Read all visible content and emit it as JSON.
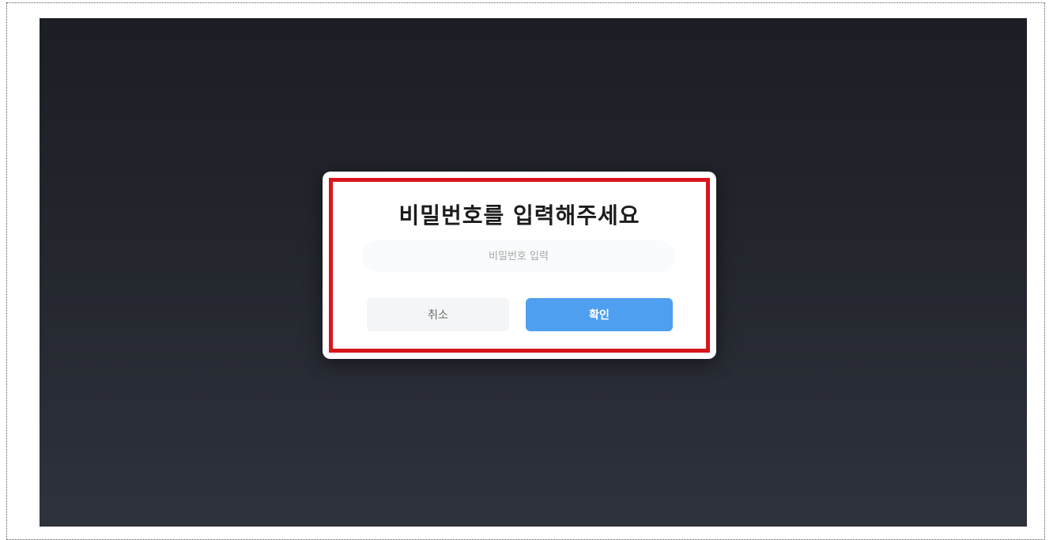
{
  "dialog": {
    "title": "비밀번호를 입력해주세요",
    "password_input": {
      "placeholder": "비밀번호 입력",
      "value": ""
    },
    "cancel_label": "취소",
    "confirm_label": "확인"
  },
  "colors": {
    "highlight": "#d7161d",
    "confirm_button": "#4f9ff1",
    "backdrop": "#23262d"
  }
}
